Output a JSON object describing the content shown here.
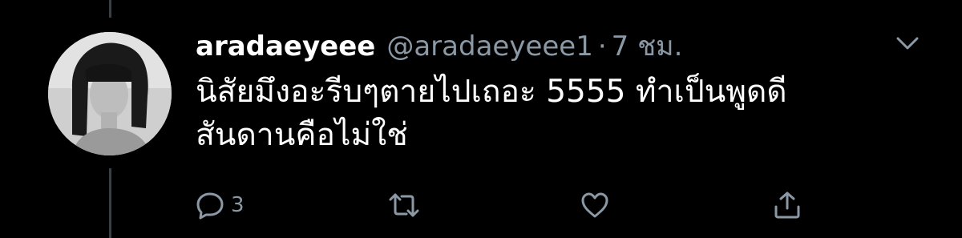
{
  "tweet": {
    "display_name": "aradaeyeee",
    "handle": "@aradaeyeee1",
    "separator": "·",
    "time": "7 ชม.",
    "text_lines": [
      "นิสัยมึงอะรีบๆตายไปเถอะ 5555 ทำเป็นพูดดี",
      "สันดานคือไม่ใช่"
    ]
  },
  "actions": {
    "reply": {
      "icon": "reply-icon",
      "count": "3"
    },
    "retweet": {
      "icon": "retweet-icon"
    },
    "like": {
      "icon": "heart-icon"
    },
    "share": {
      "icon": "share-icon"
    }
  },
  "menu": {
    "icon": "chevron-down-icon"
  },
  "colors": {
    "background": "#000000",
    "text": "#ffffff",
    "secondary": "#8b98a5",
    "thread_line": "#3a3f44"
  }
}
